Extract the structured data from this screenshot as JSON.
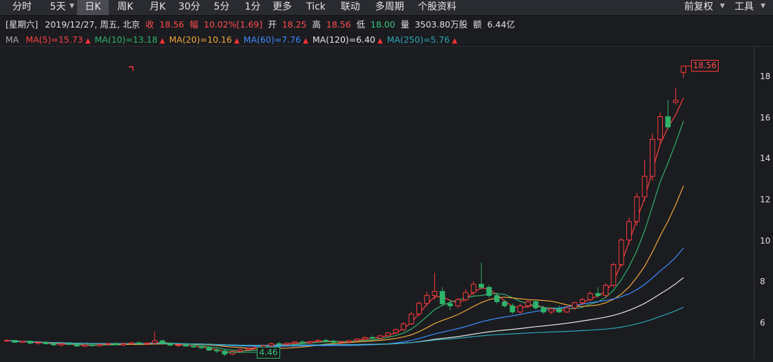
{
  "toolbar": {
    "tabs": [
      "分时",
      "5天",
      "日K",
      "周K",
      "月K",
      "30分",
      "5分",
      "1分",
      "更多",
      "Tick",
      "联动",
      "多周期",
      "个股资料"
    ],
    "right": [
      "前复权",
      "工具"
    ]
  },
  "info": {
    "day": "[星期六]",
    "date": "2019/12/27, 周五, 北京",
    "close_label": "收",
    "close": "18.56",
    "change_label": "幅",
    "change": "10.02%",
    "change_abs": "[1.69]",
    "open_label": "开",
    "open": "18.25",
    "high_label": "高",
    "high": "18.56",
    "low_label": "低",
    "low": "18.00",
    "volume_label": "量",
    "volume": "3503.80万股",
    "amount_label": "额",
    "amount": "6.44亿"
  },
  "ma": {
    "label": "MA",
    "items": [
      {
        "text": "MA(5)=15.73",
        "color": "#ff4040"
      },
      {
        "text": "MA(10)=13.18",
        "color": "#2fb36b"
      },
      {
        "text": "MA(20)=10.16",
        "color": "#f2a93b"
      },
      {
        "text": "MA(60)=7.76",
        "color": "#3d8bff"
      },
      {
        "text": "MA(120)=6.40",
        "color": "#e8e8e8"
      },
      {
        "text": "MA(250)=5.76",
        "color": "#2aa6b8"
      }
    ]
  },
  "axis": {
    "ticks": [
      "18",
      "16",
      "14",
      "12",
      "10",
      "8",
      "6"
    ]
  },
  "labels": {
    "high_mark": "18.56",
    "low_mark": "4.46"
  },
  "chart_data": {
    "type": "candlestick",
    "ylim": [
      4.3,
      19.5
    ],
    "y_ticks": [
      6,
      8,
      10,
      12,
      14,
      16,
      18
    ],
    "colors": {
      "up": "#ff3b3b",
      "down": "#2fb36b"
    },
    "ma_colors": {
      "ma5": "#ff4040",
      "ma10": "#2fb36b",
      "ma20": "#f2a93b",
      "ma60": "#3d8bff",
      "ma120": "#e8e8e8",
      "ma250": "#2aa6b8"
    },
    "candles": [
      [
        5.2,
        5.25,
        5.15,
        5.22
      ],
      [
        5.22,
        5.24,
        5.1,
        5.12
      ],
      [
        5.12,
        5.2,
        5.08,
        5.18
      ],
      [
        5.18,
        5.22,
        5.05,
        5.08
      ],
      [
        5.08,
        5.15,
        5.0,
        5.12
      ],
      [
        5.12,
        5.18,
        5.02,
        5.05
      ],
      [
        5.05,
        5.1,
        4.95,
        5.0
      ],
      [
        5.0,
        5.08,
        4.92,
        5.06
      ],
      [
        5.06,
        5.12,
        4.98,
        5.02
      ],
      [
        5.02,
        5.08,
        4.9,
        4.94
      ],
      [
        4.94,
        5.02,
        4.88,
        5.0
      ],
      [
        5.0,
        5.06,
        4.92,
        4.96
      ],
      [
        4.96,
        5.04,
        4.9,
        5.02
      ],
      [
        5.02,
        5.1,
        4.95,
        5.06
      ],
      [
        5.06,
        5.12,
        4.98,
        5.0
      ],
      [
        5.0,
        5.08,
        4.94,
        5.05
      ],
      [
        5.05,
        5.14,
        5.0,
        5.1
      ],
      [
        5.1,
        5.16,
        5.02,
        5.04
      ],
      [
        5.04,
        5.12,
        4.98,
        5.08
      ],
      [
        5.08,
        5.66,
        5.02,
        5.2
      ],
      [
        5.2,
        5.24,
        5.04,
        5.08
      ],
      [
        5.08,
        5.12,
        4.95,
        4.98
      ],
      [
        4.98,
        5.04,
        4.9,
        5.0
      ],
      [
        5.0,
        5.06,
        4.92,
        4.94
      ],
      [
        4.94,
        5.0,
        4.85,
        4.9
      ],
      [
        4.9,
        4.96,
        4.8,
        4.86
      ],
      [
        4.86,
        4.92,
        4.7,
        4.74
      ],
      [
        4.74,
        4.82,
        4.6,
        4.7
      ],
      [
        4.7,
        4.76,
        4.46,
        4.55
      ],
      [
        4.55,
        4.72,
        4.5,
        4.68
      ],
      [
        4.68,
        4.8,
        4.62,
        4.76
      ],
      [
        4.76,
        4.86,
        4.7,
        4.82
      ],
      [
        4.82,
        4.92,
        4.76,
        4.88
      ],
      [
        4.88,
        5.0,
        4.82,
        4.96
      ],
      [
        4.96,
        5.1,
        4.9,
        5.06
      ],
      [
        5.06,
        5.14,
        4.98,
        5.02
      ],
      [
        5.02,
        5.1,
        4.96,
        5.08
      ],
      [
        5.08,
        5.18,
        5.02,
        5.14
      ],
      [
        5.14,
        5.22,
        5.06,
        5.1
      ],
      [
        5.1,
        5.2,
        5.04,
        5.16
      ],
      [
        5.16,
        5.28,
        5.1,
        5.22
      ],
      [
        5.22,
        5.3,
        5.12,
        5.18
      ],
      [
        5.18,
        5.26,
        5.08,
        5.12
      ],
      [
        5.12,
        5.2,
        5.04,
        5.14
      ],
      [
        5.14,
        5.24,
        5.08,
        5.2
      ],
      [
        5.2,
        5.32,
        5.14,
        5.28
      ],
      [
        5.28,
        5.4,
        5.22,
        5.36
      ],
      [
        5.36,
        5.46,
        5.28,
        5.32
      ],
      [
        5.32,
        5.48,
        5.26,
        5.44
      ],
      [
        5.44,
        5.62,
        5.38,
        5.58
      ],
      [
        5.58,
        5.8,
        5.52,
        5.74
      ],
      [
        5.74,
        6.1,
        5.66,
        6.02
      ],
      [
        6.02,
        6.6,
        5.96,
        6.5
      ],
      [
        6.5,
        7.1,
        6.4,
        7.02
      ],
      [
        7.02,
        7.6,
        6.9,
        7.4
      ],
      [
        7.4,
        8.5,
        7.2,
        7.6
      ],
      [
        7.6,
        7.8,
        6.9,
        7.0
      ],
      [
        7.0,
        7.2,
        6.7,
        6.9
      ],
      [
        6.9,
        7.3,
        6.8,
        7.2
      ],
      [
        7.2,
        7.7,
        7.1,
        7.55
      ],
      [
        7.55,
        8.1,
        7.4,
        7.95
      ],
      [
        7.95,
        9.0,
        7.7,
        7.8
      ],
      [
        7.8,
        7.9,
        7.3,
        7.4
      ],
      [
        7.4,
        7.5,
        7.0,
        7.1
      ],
      [
        7.1,
        7.2,
        6.8,
        6.9
      ],
      [
        6.9,
        7.0,
        6.5,
        6.6
      ],
      [
        6.6,
        7.0,
        6.5,
        6.9
      ],
      [
        6.9,
        7.2,
        6.8,
        7.1
      ],
      [
        7.1,
        7.2,
        6.7,
        6.8
      ],
      [
        6.8,
        6.9,
        6.5,
        6.6
      ],
      [
        6.6,
        6.8,
        6.5,
        6.75
      ],
      [
        6.75,
        6.9,
        6.55,
        6.6
      ],
      [
        6.6,
        6.85,
        6.55,
        6.8
      ],
      [
        6.8,
        7.1,
        6.7,
        7.05
      ],
      [
        7.05,
        7.3,
        6.95,
        7.2
      ],
      [
        7.2,
        7.6,
        7.1,
        7.5
      ],
      [
        7.5,
        7.8,
        7.3,
        7.4
      ],
      [
        7.4,
        8.0,
        7.3,
        7.9
      ],
      [
        7.9,
        9.0,
        7.8,
        8.9
      ],
      [
        8.9,
        10.2,
        8.8,
        10.1
      ],
      [
        10.1,
        11.2,
        9.9,
        11.0
      ],
      [
        11.0,
        12.4,
        10.8,
        12.2
      ],
      [
        12.2,
        14.0,
        12.0,
        13.2
      ],
      [
        13.2,
        15.3,
        13.0,
        15.0
      ],
      [
        15.0,
        16.3,
        14.8,
        16.1
      ],
      [
        16.1,
        16.9,
        15.5,
        15.6
      ],
      [
        16.8,
        17.5,
        16.7,
        16.9
      ],
      [
        18.25,
        18.56,
        18.0,
        18.56
      ]
    ]
  }
}
